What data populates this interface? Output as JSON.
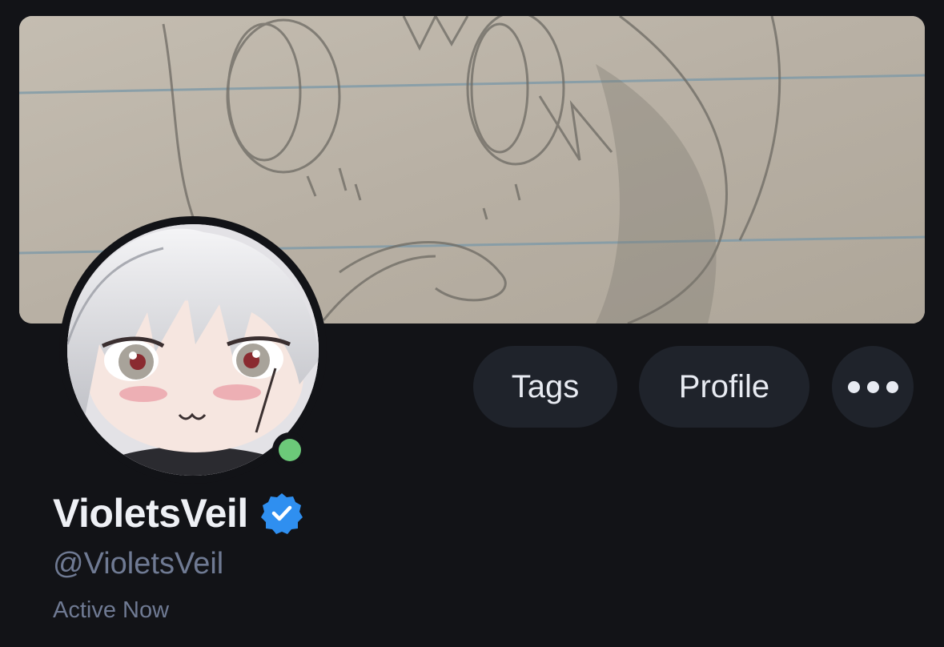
{
  "profile": {
    "display_name": "VioletsVeil",
    "handle": "@VioletsVeil",
    "status": "Active Now",
    "verified": true,
    "online": true
  },
  "actions": {
    "tags_label": "Tags",
    "profile_label": "Profile",
    "more_icon": "more-horizontal-icon"
  },
  "colors": {
    "background": "#121317",
    "button_bg": "#1f232b",
    "verified_blue": "#2f8ff0",
    "online_green": "#6cc979",
    "muted_text": "#6f7a93"
  },
  "images": {
    "banner": "pencil sketch on lined paper",
    "avatar": "chibi figure with silver hair"
  }
}
